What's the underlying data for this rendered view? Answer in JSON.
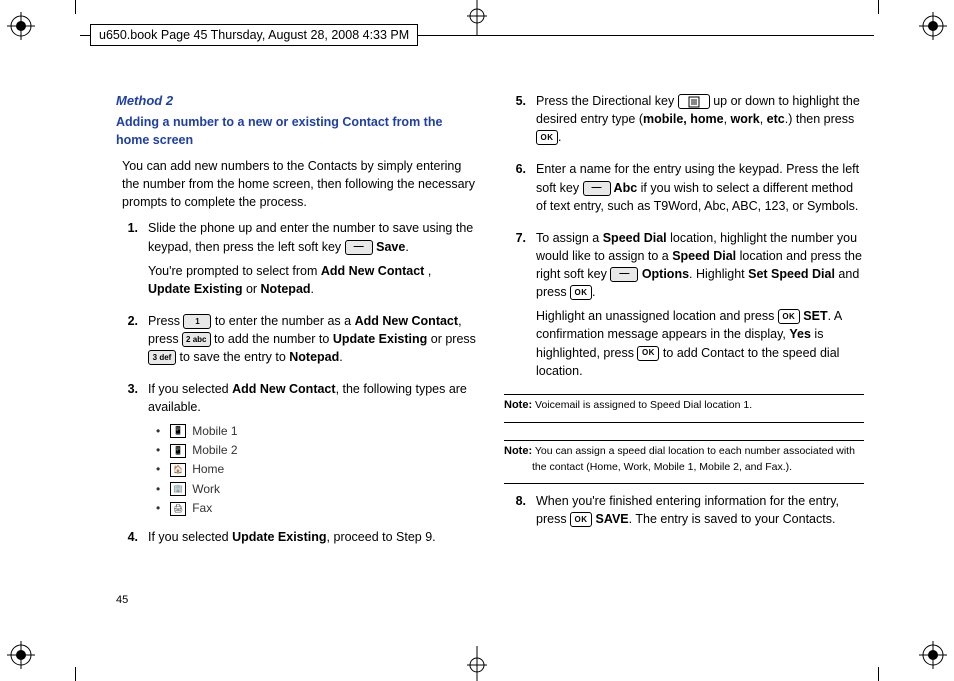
{
  "header": "u650.book  Page 45  Thursday, August 28, 2008  4:33 PM",
  "page_num": "45",
  "left": {
    "method": "Method 2",
    "subtitle": "Adding a number to a new or existing Contact from the home screen",
    "intro": "You can add new numbers to the Contacts by simply entering the number from the home screen, then following the necessary prompts to complete the process.",
    "step1": {
      "num": "1.",
      "p1a": "Slide the phone up and enter the number to save using the keypad, then press the left soft key ",
      "p1b": " Save",
      "p1c": ".",
      "p2a": "You're prompted to select from ",
      "p2b": "Add New Contact",
      "p2c": " , ",
      "p2d": "Update Existing",
      "p2e": " or ",
      "p2f": "Notepad",
      "p2g": "."
    },
    "step2": {
      "num": "2.",
      "a": "Press ",
      "b": " to enter the number as a ",
      "c": "Add New Contact",
      "d": ", press ",
      "e": " to add the number to ",
      "f": "Update Existing",
      "g": " or press ",
      "h": " to save the entry to ",
      "i": "Notepad",
      "j": ".",
      "key1": "1",
      "key2": "2 abc",
      "key3": "3 def"
    },
    "step3": {
      "num": "3.",
      "a": "If you selected ",
      "b": "Add New Contact",
      "c": ", the following types are available."
    },
    "types": [
      "Mobile 1",
      "Mobile 2",
      "Home",
      "Work",
      "Fax"
    ],
    "step4": {
      "num": "4.",
      "a": "If you selected ",
      "b": "Update Existing",
      "c": ", proceed to Step 9."
    }
  },
  "right": {
    "step5": {
      "num": "5.",
      "a": "Press the Directional key ",
      "b": " up or down to highlight the desired entry type (",
      "c": "mobile, home",
      "d": ", ",
      "e": "work",
      "f": ", ",
      "g": "etc",
      "h": ".) then press ",
      "i": "."
    },
    "step6": {
      "num": "6.",
      "a": "Enter a name for the entry using the keypad. Press the left soft key ",
      "b": " Abc",
      "c": " if you wish to select a different method of text entry, such as T9Word, Abc, ABC, 123, or Symbols."
    },
    "step7": {
      "num": "7.",
      "a": "To assign a ",
      "b": "Speed Dial",
      "c": " location, highlight the number you would like to assign to a ",
      "d": "Speed Dial",
      "e": " location and press the right soft key ",
      "f": " Options",
      "g": ". Highlight ",
      "h": "Set Speed Dial",
      "i": " and press ",
      "j": ".",
      "p2a": "Highlight an unassigned location and press ",
      "p2b": " SET",
      "p2c": ". A confirmation message appears in the display, ",
      "p2d": "Yes",
      "p2e": " is highlighted, press ",
      "p2f": " to add Contact to the speed dial location."
    },
    "note1": {
      "label": "Note:",
      "text": " Voicemail is assigned to Speed Dial location 1."
    },
    "note2": {
      "label": "Note:",
      "text": " You can assign a speed dial location to each number associated with the contact (Home, Work, Mobile 1, Mobile 2, and Fax.)."
    },
    "step8": {
      "num": "8.",
      "a": "When you're finished entering information for the entry, press ",
      "b": " SAVE",
      "c": ". The entry is saved to your Contacts."
    },
    "ok_label": "OK"
  }
}
